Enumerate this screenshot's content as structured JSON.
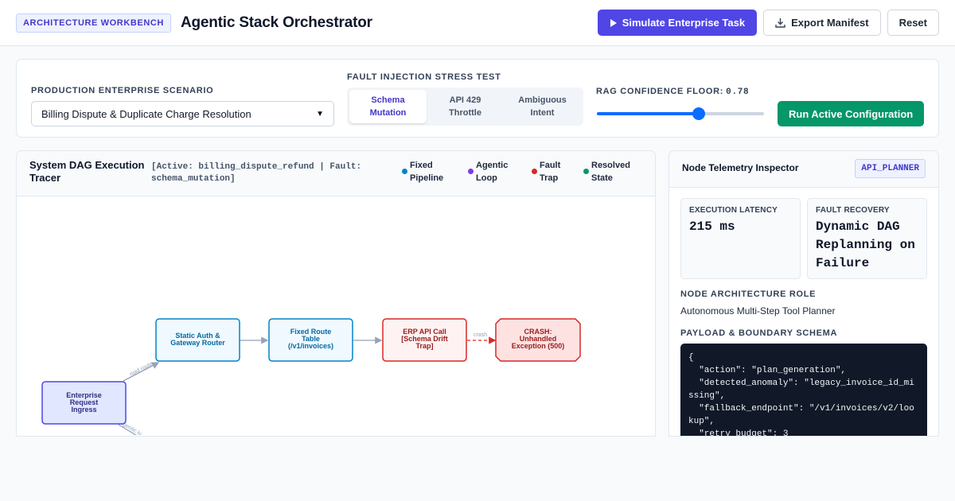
{
  "header": {
    "badge": "ARCHITECTURE WORKBENCH",
    "title": "Agentic Stack Orchestrator",
    "simulate_label": "Simulate Enterprise Task",
    "export_label": "Export Manifest",
    "reset_label": "Reset"
  },
  "config": {
    "scenario_label": "PRODUCTION ENTERPRISE SCENARIO",
    "scenario_value": "Billing Dispute & Duplicate Charge Resolution",
    "fault_label": "FAULT INJECTION STRESS TEST",
    "fault_options": [
      "Schema Mutation",
      "API 429 Throttle",
      "Ambiguous Intent"
    ],
    "fault_selected": "Schema Mutation",
    "rag_label": "RAG CONFIDENCE FLOOR:",
    "rag_value": "0.78",
    "rag_level": 0.61,
    "run_label": "Run Active Configuration"
  },
  "dag": {
    "title": "System DAG Execution Tracer",
    "status": "[Active: billing_dispute_refund | Fault: schema_mutation]",
    "legend": [
      {
        "label": "Fixed Pipeline",
        "color": "#0284c7"
      },
      {
        "label": "Agentic Loop",
        "color": "#7c3aed"
      },
      {
        "label": "Fault Trap",
        "color": "#dc2626"
      },
      {
        "label": "Resolved State",
        "color": "#059669"
      }
    ],
    "nodes": [
      {
        "id": "ingress",
        "lines": [
          "Enterprise",
          "Request",
          "Ingress"
        ],
        "kind": "ingress"
      },
      {
        "id": "auth",
        "lines": [
          "Static Auth &",
          "Gateway Router"
        ],
        "kind": "fixed"
      },
      {
        "id": "route",
        "lines": [
          "Fixed Route",
          "Table",
          "(/v1/invoices)"
        ],
        "kind": "fixed"
      },
      {
        "id": "erp",
        "lines": [
          "ERP API Call",
          "[Schema Drift",
          "Trap]"
        ],
        "kind": "fault"
      },
      {
        "id": "crash",
        "lines": [
          "CRASH:",
          "Unhandled",
          "Exception (500)"
        ],
        "kind": "crash"
      }
    ],
    "edge_labels": {
      "rigid": "rigid route",
      "crash": "crash",
      "agentic": "agentic lo"
    }
  },
  "inspector": {
    "title": "Node Telemetry Inspector",
    "node_id": "API_PLANNER",
    "latency_label": "EXECUTION LATENCY",
    "latency_value": "215 ms",
    "recovery_label": "FAULT RECOVERY",
    "recovery_value": "Dynamic DAG Replanning on Failure",
    "role_label": "NODE ARCHITECTURE ROLE",
    "role_value": "Autonomous Multi-Step Tool Planner",
    "payload_label": "PAYLOAD & BOUNDARY SCHEMA",
    "payload": "{\n  \"action\": \"plan_generation\",\n  \"detected_anomaly\": \"legacy_invoice_id_missing\",\n  \"fallback_endpoint\": \"/v1/invoices/v2/lookup\",\n  \"retry_budget\": 3\n}"
  }
}
